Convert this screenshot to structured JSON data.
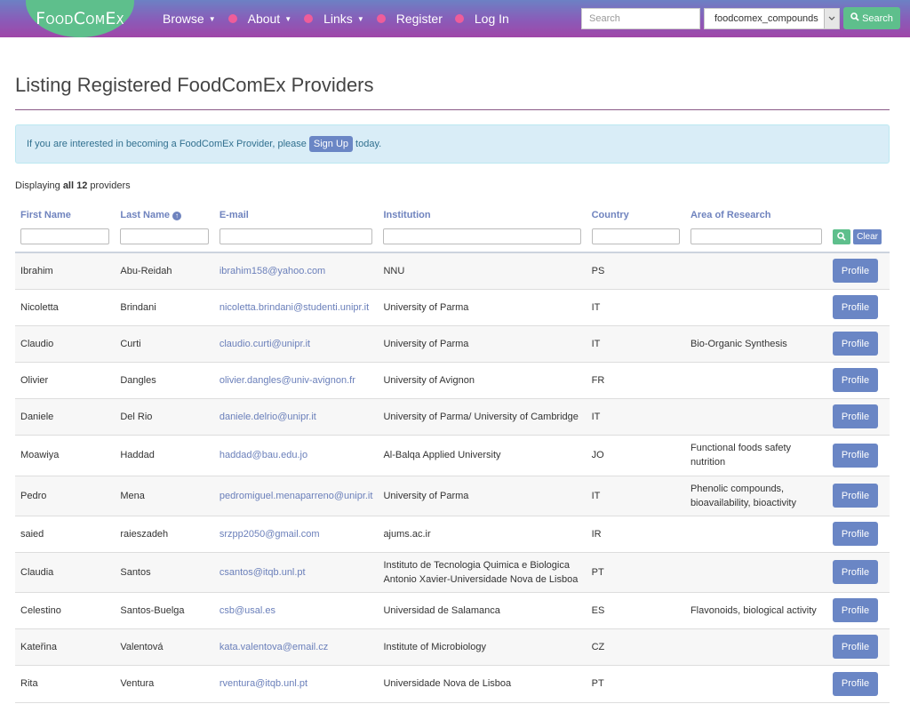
{
  "navbar": {
    "brand": "FoodComEx",
    "items": [
      {
        "label": "Browse",
        "dropdown": true
      },
      {
        "label": "About",
        "dropdown": true
      },
      {
        "label": "Links",
        "dropdown": true
      },
      {
        "label": "Register",
        "dropdown": false
      },
      {
        "label": "Log In",
        "dropdown": false
      }
    ],
    "search_placeholder": "Search",
    "database_selected": "foodcomex_compounds",
    "search_button": "Search"
  },
  "page": {
    "title": "Listing Registered FoodComEx Providers",
    "alert_prefix": "If you are interested in becoming a FoodComEx Provider, please",
    "alert_button": "Sign Up",
    "alert_suffix": "today.",
    "count_prefix": "Displaying",
    "count_bold": "all 12",
    "count_suffix": "providers"
  },
  "table": {
    "columns": [
      "First Name",
      "Last Name",
      "E-mail",
      "Institution",
      "Country",
      "Area of Research"
    ],
    "sorted_column": "Last Name",
    "clear_label": "Clear",
    "profile_label": "Profile",
    "rows": [
      {
        "first": "Ibrahim",
        "last": "Abu-Reidah",
        "email": "ibrahim158@yahoo.com",
        "institution": "NNU",
        "country": "PS",
        "area": ""
      },
      {
        "first": "Nicoletta",
        "last": "Brindani",
        "email": "nicoletta.brindani@studenti.unipr.it",
        "institution": "University of Parma",
        "country": "IT",
        "area": ""
      },
      {
        "first": "Claudio",
        "last": "Curti",
        "email": "claudio.curti@unipr.it",
        "institution": "University of Parma",
        "country": "IT",
        "area": "Bio-Organic Synthesis"
      },
      {
        "first": "Olivier",
        "last": "Dangles",
        "email": "olivier.dangles@univ-avignon.fr",
        "institution": "University of Avignon",
        "country": "FR",
        "area": ""
      },
      {
        "first": "Daniele",
        "last": "Del Rio",
        "email": "daniele.delrio@unipr.it",
        "institution": "University of Parma/ University of Cambridge",
        "country": "IT",
        "area": ""
      },
      {
        "first": "Moawiya",
        "last": "Haddad",
        "email": "haddad@bau.edu.jo",
        "institution": "Al-Balqa Applied University",
        "country": "JO",
        "area": "Functional foods safety nutrition"
      },
      {
        "first": "Pedro",
        "last": "Mena",
        "email": "pedromiguel.menaparreno@unipr.it",
        "institution": "University of Parma",
        "country": "IT",
        "area": "Phenolic compounds, bioavailability, bioactivity"
      },
      {
        "first": "saied",
        "last": "raieszadeh",
        "email": "srzpp2050@gmail.com",
        "institution": "ajums.ac.ir",
        "country": "IR",
        "area": ""
      },
      {
        "first": "Claudia",
        "last": "Santos",
        "email": "csantos@itqb.unl.pt",
        "institution": "Instituto de Tecnologia Quimica e Biologica Antonio Xavier-Universidade Nova de Lisboa",
        "country": "PT",
        "area": ""
      },
      {
        "first": "Celestino",
        "last": "Santos-Buelga",
        "email": "csb@usal.es",
        "institution": "Universidad de Salamanca",
        "country": "ES",
        "area": "Flavonoids, biological activity"
      },
      {
        "first": "Kateřina",
        "last": "Valentová",
        "email": "kata.valentova@email.cz",
        "institution": "Institute of Microbiology",
        "country": "CZ",
        "area": ""
      },
      {
        "first": "Rita",
        "last": "Ventura",
        "email": "rventura@itqb.unl.pt",
        "institution": "Universidade Nova de Lisboa",
        "country": "PT",
        "area": ""
      }
    ]
  },
  "colors": {
    "brand_green": "#5ebf8c",
    "primary_blue": "#6a86c5",
    "nav_dot_pink": "#ee5d9a",
    "header_link": "#6f83be"
  }
}
